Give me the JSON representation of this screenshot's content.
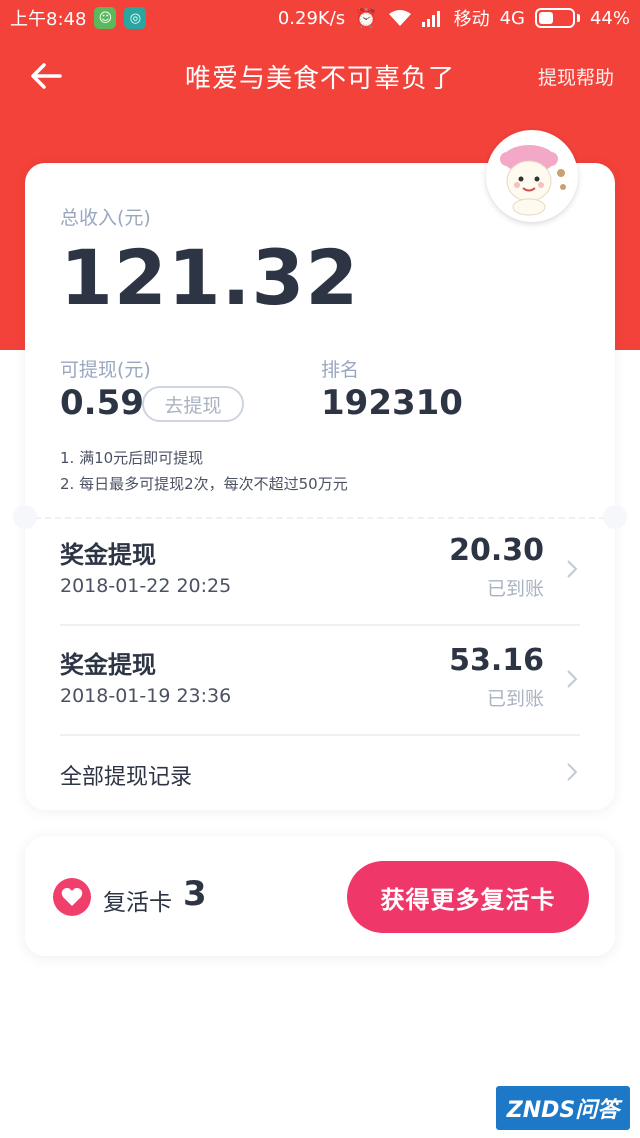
{
  "status_bar": {
    "time": "上午8:48",
    "speed": "0.29K/s",
    "carrier": "移动",
    "network": "4G",
    "battery": "44%",
    "battery_level": 0.44
  },
  "nav": {
    "title": "唯爱与美食不可辜负了",
    "help_label": "提现帮助"
  },
  "earnings": {
    "total_label": "总收入(元)",
    "total_amount": "121.32",
    "withdrawable_label": "可提现(元)",
    "withdrawable_amount": "0.59",
    "withdraw_button": "去提现",
    "rank_label": "排名",
    "rank_value": "192310",
    "rules": [
      "1. 满10元后即可提现",
      "2. 每日最多可提现2次，每次不超过50万元"
    ]
  },
  "records": [
    {
      "title": "奖金提现",
      "time": "2018-01-22 20:25",
      "amount": "20.30",
      "status": "已到账"
    },
    {
      "title": "奖金提现",
      "time": "2018-01-19 23:36",
      "amount": "53.16",
      "status": "已到账"
    }
  ],
  "all_records_label": "全部提现记录",
  "revive": {
    "label": "复活卡",
    "count": "3",
    "button": "获得更多复活卡"
  },
  "watermark": "ZNDS问答",
  "colors": {
    "header_red": "#f2423a",
    "accent_pink": "#f0376a"
  }
}
